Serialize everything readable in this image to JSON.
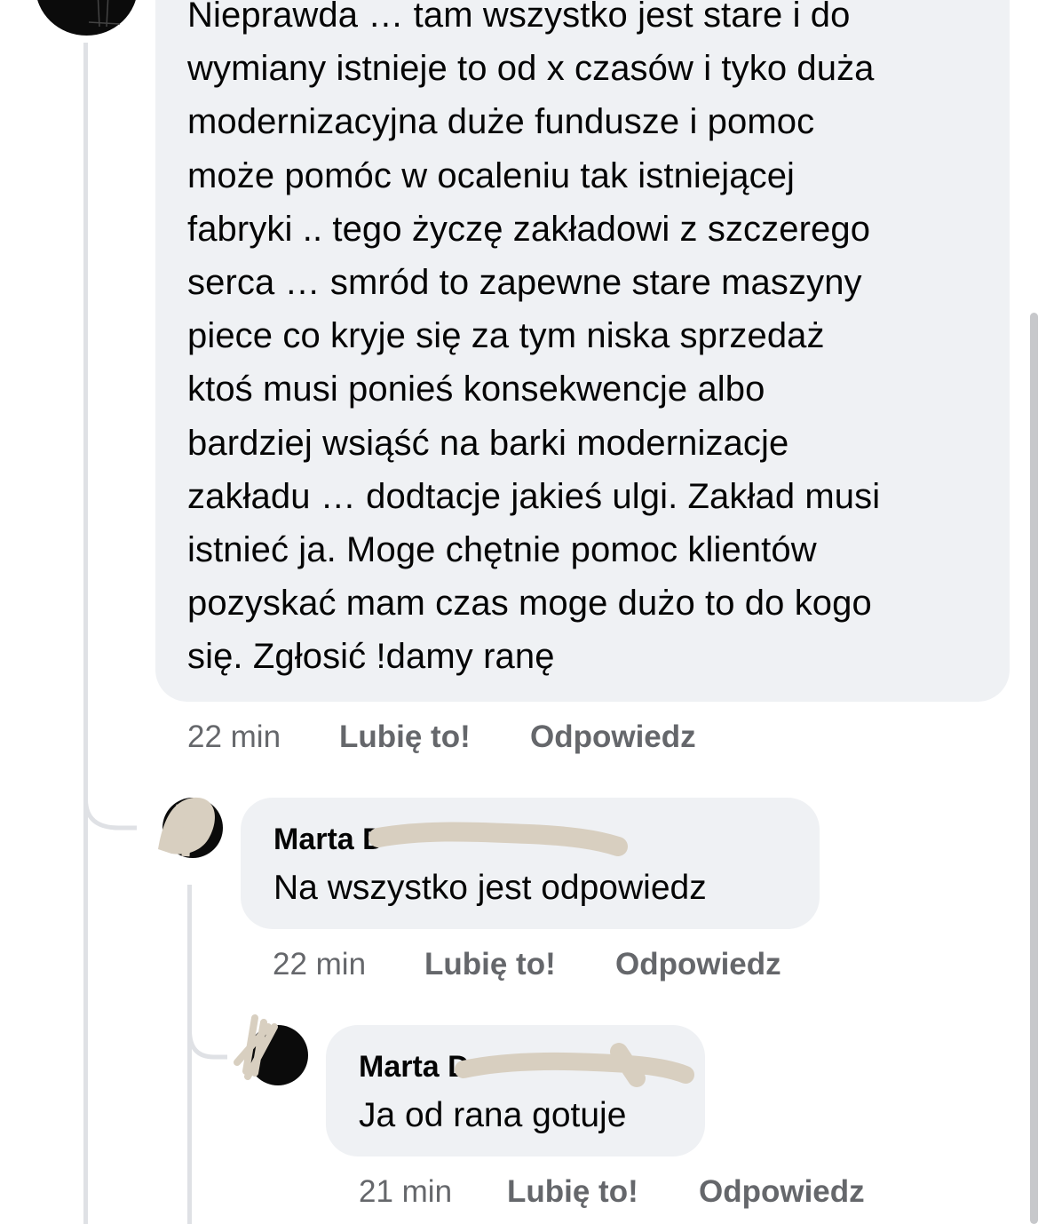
{
  "main_comment": {
    "text": "Nieprawda … tam wszystko jest stare i do\nwymiany istnieje to od x czasów i tyko duża\nmodernizacyjna duże fundusze i pomoc\nmoże pomóc w ocaleniu tak istniejącej\nfabryki .. tego życzę zakładowi z szczerego\nserca … smród to zapewne stare maszyny\npiece co kryje się za tym niska sprzedaż\nktoś musi ponieś konsekwencje albo\nbardziej wsiąść na barki modernizacje\nzakładu … dodtacje jakieś ulgi. Zakład musi\nistnieć ja. Moge chętnie pomoc klientów\npozyskać mam czas moge dużo to do kogo\nsię. Zgłosić !damy ranę",
    "time": "22 min",
    "like_label": "Lubię to!",
    "reply_label": "Odpowiedz"
  },
  "replies": [
    {
      "author": "Marta D",
      "text": "Na wszystko jest odpowiedz",
      "time": "22 min",
      "like_label": "Lubię to!",
      "reply_label": "Odpowiedz"
    },
    {
      "author": "Marta D",
      "text": "Ja od rana gotuje",
      "time": "21 min",
      "like_label": "Lubię to!",
      "reply_label": "Odpowiedz"
    }
  ],
  "colors": {
    "bubble": "#eff1f4",
    "secondary_text": "#65676b",
    "thread_line": "#dfe1e5",
    "redaction_scribble": "#d8cfc0"
  },
  "icons": [
    "avatar-main",
    "avatar-reply-1",
    "avatar-reply-2",
    "name-redaction-scribble"
  ]
}
